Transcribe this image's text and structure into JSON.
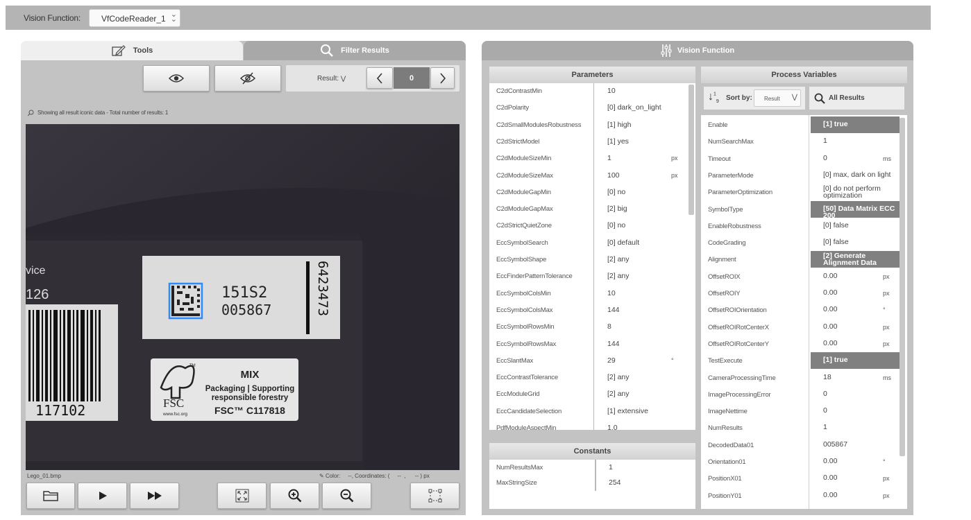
{
  "header": {
    "label": "Vision Function:",
    "selected": "VfCodeReader_1"
  },
  "left_panel": {
    "tabs": [
      {
        "label": "Tools"
      },
      {
        "label": "Filter Results"
      }
    ],
    "result_label": "Result:",
    "result_value": "0",
    "status_text": "Showing all result iconic data - Total number of results: 1",
    "image_texts": {
      "label_code1": "151S2",
      "label_code2": "005867",
      "vertical_number": "6423473",
      "barcode_number": "117102",
      "partial_word": "vice",
      "partial_number": "126",
      "fsc_mix": "MIX",
      "fsc_line1": "Packaging | Supporting",
      "fsc_line2": "responsible forestry",
      "fsc_code": "FSC™ C117818",
      "fsc_name": "FSC",
      "fsc_url": "www.fsc.org",
      "fsc_tm": "TM"
    },
    "filename": "Lego_01.bmp",
    "coords_text": "Color:     --, Coordinates: (     --  ,      -- ) px"
  },
  "right_panel": {
    "title": "Vision Function",
    "parameters_header": "Parameters",
    "parameters": [
      {
        "name": "C2dContrastMin",
        "value": "10",
        "unit": ""
      },
      {
        "name": "C2dPolarity",
        "value": "[0] dark_on_light",
        "unit": ""
      },
      {
        "name": "C2dSmallModulesRobustness",
        "value": "[1] high",
        "unit": ""
      },
      {
        "name": "C2dStrictModel",
        "value": "[1] yes",
        "unit": ""
      },
      {
        "name": "C2dModuleSizeMin",
        "value": "1",
        "unit": "px"
      },
      {
        "name": "C2dModuleSizeMax",
        "value": "100",
        "unit": "px"
      },
      {
        "name": "C2dModuleGapMin",
        "value": "[0] no",
        "unit": ""
      },
      {
        "name": "C2dModuleGapMax",
        "value": "[2] big",
        "unit": ""
      },
      {
        "name": "C2dStrictQuietZone",
        "value": "[0] no",
        "unit": ""
      },
      {
        "name": "EccSymbolSearch",
        "value": "[0] default",
        "unit": ""
      },
      {
        "name": "EccSymbolShape",
        "value": "[2] any",
        "unit": ""
      },
      {
        "name": "EccFinderPatternTolerance",
        "value": "[2] any",
        "unit": ""
      },
      {
        "name": "EccSymbolColsMin",
        "value": "10",
        "unit": ""
      },
      {
        "name": "EccSymbolColsMax",
        "value": "144",
        "unit": ""
      },
      {
        "name": "EccSymbolRowsMin",
        "value": "8",
        "unit": ""
      },
      {
        "name": "EccSymbolRowsMax",
        "value": "144",
        "unit": ""
      },
      {
        "name": "EccSlantMax",
        "value": "29",
        "unit": "°"
      },
      {
        "name": "EccContrastTolerance",
        "value": "[2] any",
        "unit": ""
      },
      {
        "name": "EccModuleGrid",
        "value": "[2] any",
        "unit": ""
      },
      {
        "name": "EccCandidateSelection",
        "value": "[1] extensive",
        "unit": ""
      },
      {
        "name": "PdfModuleAspectMin",
        "value": "1.0",
        "unit": ""
      }
    ],
    "constants_header": "Constants",
    "constants": [
      {
        "name": "NumResultsMax",
        "value": "1"
      },
      {
        "name": "MaxStringSize",
        "value": "254"
      }
    ],
    "process_header": "Process Variables",
    "sort_label": "Sort by:",
    "sort_value": "Result",
    "search_label": "All Results",
    "variables": [
      {
        "name": "Enable",
        "value": "[1] true",
        "unit": "",
        "hl": true
      },
      {
        "name": "NumSearchMax",
        "value": "1",
        "unit": "",
        "hl": false
      },
      {
        "name": "Timeout",
        "value": "0",
        "unit": "ms",
        "hl": false
      },
      {
        "name": "ParameterMode",
        "value": "[0] max, dark on light",
        "unit": "",
        "hl": false
      },
      {
        "name": "ParameterOptimization",
        "value": "[0] do not perform optimization",
        "unit": "",
        "hl": false
      },
      {
        "name": "SymbolType",
        "value": "[50] Data Matrix ECC 200",
        "unit": "",
        "hl": true
      },
      {
        "name": "EnableRobustness",
        "value": "[0] false",
        "unit": "",
        "hl": false
      },
      {
        "name": "CodeGrading",
        "value": "[0] false",
        "unit": "",
        "hl": false
      },
      {
        "name": "Alignment",
        "value": "[2] Generate Alignment Data",
        "unit": "",
        "hl": true
      },
      {
        "name": "OffsetROIX",
        "value": "0.00",
        "unit": "px",
        "hl": false
      },
      {
        "name": "OffsetROIY",
        "value": "0.00",
        "unit": "px",
        "hl": false
      },
      {
        "name": "OffsetROIOrientation",
        "value": "0.00",
        "unit": "°",
        "hl": false
      },
      {
        "name": "OffsetROIRotCenterX",
        "value": "0.00",
        "unit": "px",
        "hl": false
      },
      {
        "name": "OffsetROIRotCenterY",
        "value": "0.00",
        "unit": "px",
        "hl": false
      },
      {
        "name": "TestExecute",
        "value": "[1] true",
        "unit": "",
        "hl": true
      },
      {
        "name": "CameraProcessingTime",
        "value": "18",
        "unit": "ms",
        "hl": false
      },
      {
        "name": "ImageProcessingError",
        "value": "0",
        "unit": "",
        "hl": false
      },
      {
        "name": "ImageNettime",
        "value": "0",
        "unit": "",
        "hl": false
      },
      {
        "name": "NumResults",
        "value": "1",
        "unit": "",
        "hl": false
      },
      {
        "name": "DecodedData01",
        "value": "005867",
        "unit": "",
        "hl": false
      },
      {
        "name": "Orientation01",
        "value": "0.00",
        "unit": "°",
        "hl": false
      },
      {
        "name": "PositionX01",
        "value": "0.00",
        "unit": "px",
        "hl": false
      },
      {
        "name": "PositionY01",
        "value": "0.00",
        "unit": "px",
        "hl": false
      }
    ]
  }
}
